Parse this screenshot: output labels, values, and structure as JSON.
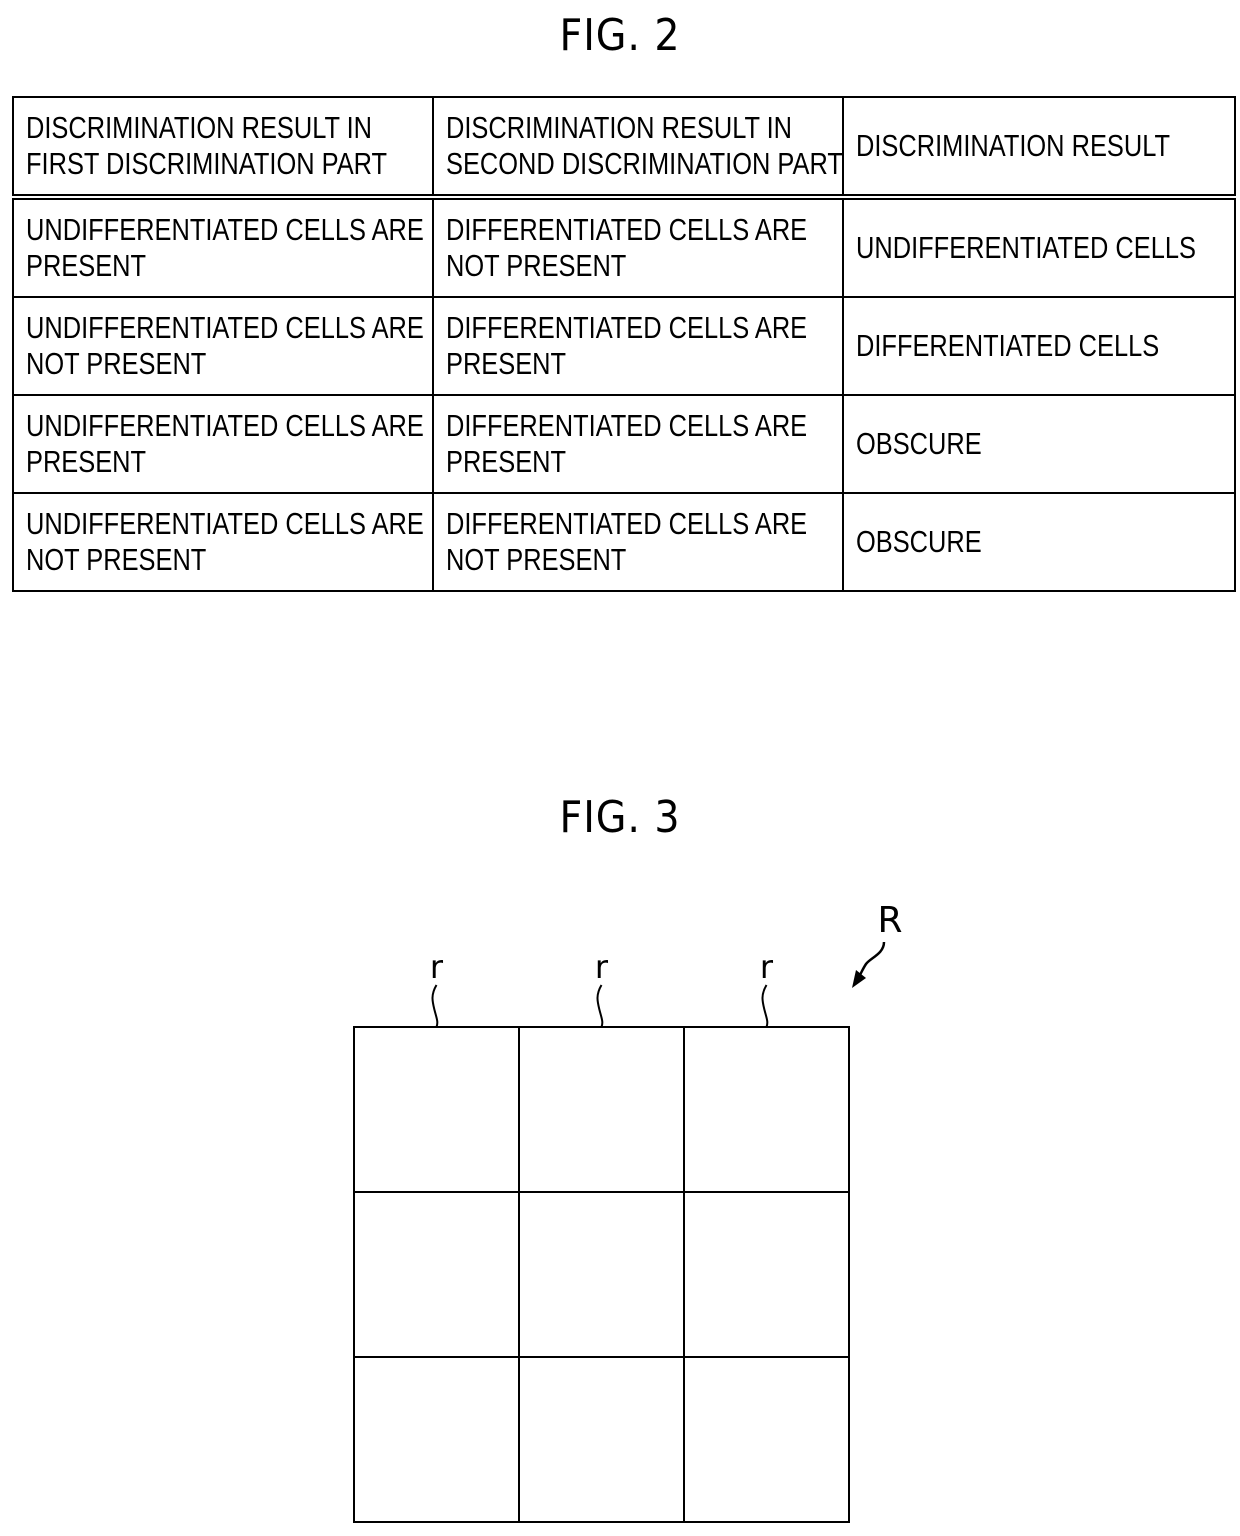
{
  "figure2": {
    "title": "FIG. 2",
    "headers": [
      [
        "DISCRIMINATION RESULT IN",
        "FIRST DISCRIMINATION PART"
      ],
      [
        "DISCRIMINATION RESULT IN",
        "SECOND DISCRIMINATION PART"
      ],
      [
        "DISCRIMINATION RESULT"
      ]
    ],
    "rows": [
      {
        "first": [
          "UNDIFFERENTIATED CELLS ARE",
          "PRESENT"
        ],
        "second": [
          "DIFFERENTIATED CELLS ARE",
          "NOT PRESENT"
        ],
        "result": "UNDIFFERENTIATED CELLS"
      },
      {
        "first": [
          "UNDIFFERENTIATED CELLS ARE",
          "NOT PRESENT"
        ],
        "second": [
          "DIFFERENTIATED CELLS ARE",
          "PRESENT"
        ],
        "result": "DIFFERENTIATED CELLS"
      },
      {
        "first": [
          "UNDIFFERENTIATED CELLS ARE",
          "PRESENT"
        ],
        "second": [
          "DIFFERENTIATED CELLS ARE",
          "PRESENT"
        ],
        "result": "OBSCURE"
      },
      {
        "first": [
          "UNDIFFERENTIATED CELLS ARE",
          "NOT PRESENT"
        ],
        "second": [
          "DIFFERENTIATED CELLS ARE",
          "NOT PRESENT"
        ],
        "result": "OBSCURE"
      }
    ]
  },
  "figure3": {
    "title": "FIG. 3",
    "region_label": "R",
    "subregion_label": "r",
    "grid_rows": 3,
    "grid_cols": 3,
    "labeled_subregions": 3
  }
}
